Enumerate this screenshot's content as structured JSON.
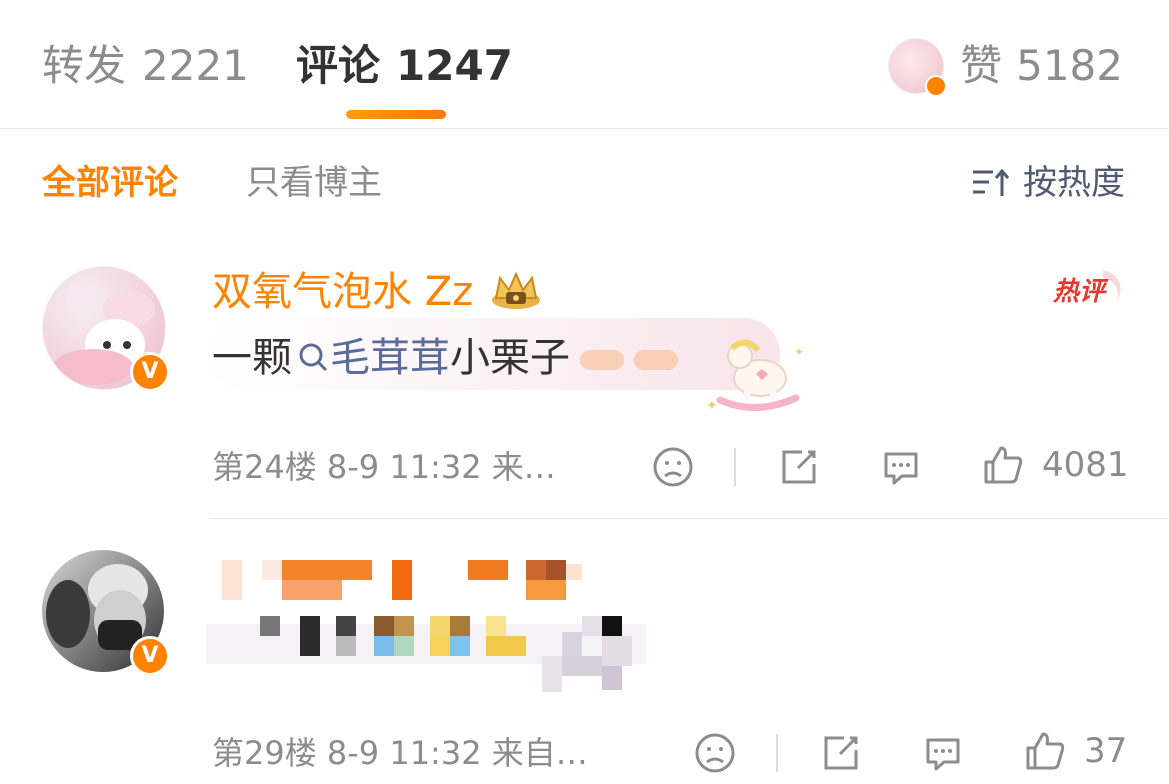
{
  "tabs": {
    "repost": {
      "label": "转发",
      "count": "2221"
    },
    "comment": {
      "label": "评论",
      "count": "1247"
    }
  },
  "likes": {
    "label": "赞",
    "count": "5182"
  },
  "filters": {
    "all": "全部评论",
    "owner_only": "只看博主",
    "sort": "按热度"
  },
  "comments": [
    {
      "username": "双氧气泡水 Zz",
      "badge": "热评",
      "text_prefix": "一颗",
      "link_text": "毛茸茸",
      "text_suffix": "小栗子",
      "meta": "第24楼 8-9 11:32 来…",
      "like_count": "4081",
      "verified": "V"
    },
    {
      "meta": "第29楼 8-9 11:32 来自…",
      "like_count": "37",
      "verified": "V"
    }
  ],
  "colors": {
    "accent": "#ff8200",
    "link": "#5b6c9a",
    "muted": "#8c8c8c"
  },
  "icons": [
    "sort-icon",
    "search-icon",
    "crown-icon",
    "dislike-icon",
    "share-icon",
    "reply-icon",
    "like-icon"
  ]
}
